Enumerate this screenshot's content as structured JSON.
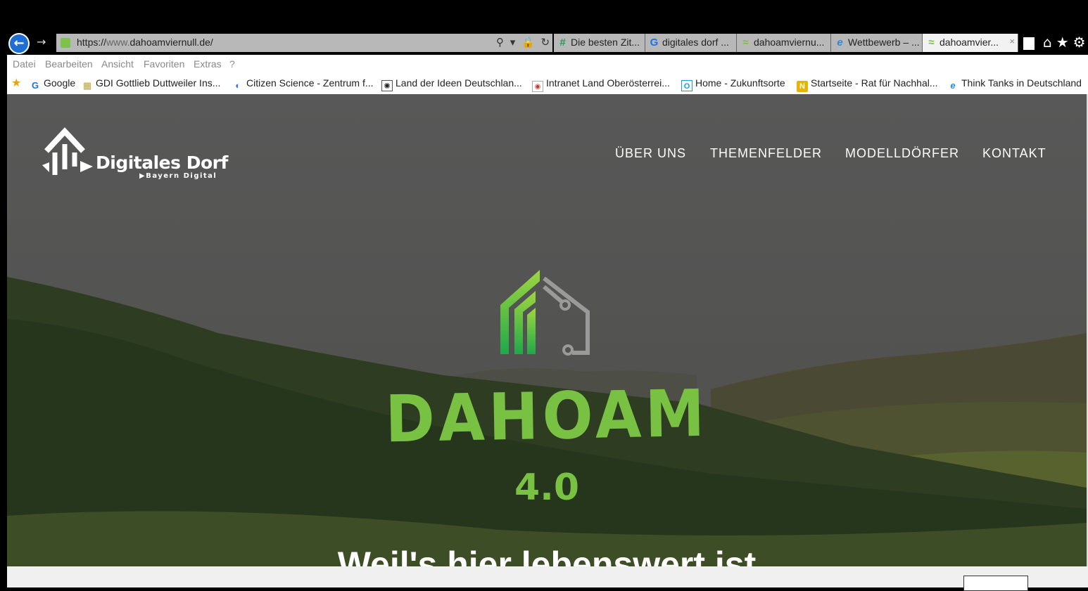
{
  "browser": {
    "url_prefix": "https://",
    "url_dim": "www.",
    "url_host": "dahoamviernull.de/",
    "address_icons": "⚲ ▾ 🔒 ↻",
    "tabs": [
      {
        "icon": "#",
        "label": "Die besten Zit..."
      },
      {
        "icon": "G",
        "label": "digitales dorf ..."
      },
      {
        "icon": "≈",
        "label": "dahoamviernu..."
      },
      {
        "icon": "e",
        "label": "Wettbewerb – ..."
      },
      {
        "icon": "≈",
        "label": "dahoamvier...",
        "close": "×"
      }
    ],
    "right_icons": "⌂★⚙"
  },
  "menu": [
    "Datei",
    "Bearbeiten",
    "Ansicht",
    "Favoriten",
    "Extras",
    "?"
  ],
  "favorites": [
    {
      "icon": "G",
      "label": "Google"
    },
    {
      "icon": "▦",
      "label": "GDI Gottlieb Duttweiler Ins..."
    },
    {
      "icon": "◐",
      "label": "Citizen Science - Zentrum f..."
    },
    {
      "icon": "✺",
      "label": "Land der Ideen  Deutschlan..."
    },
    {
      "icon": "◉",
      "label": "Intranet Land Oberösterrei..."
    },
    {
      "icon": "O",
      "label": "Home - Zukunftsorte"
    },
    {
      "icon": "N",
      "label": "Startseite - Rat für Nachhal..."
    },
    {
      "icon": "e",
      "label": "Think Tanks in Deutschland"
    }
  ],
  "site": {
    "brand_name": "Digitales Dorf",
    "brand_sub": "▶Bayern Digital",
    "nav": [
      "ÜBER UNS",
      "THEMENFELDER",
      "MODELLDÖRFER",
      "KONTAKT"
    ],
    "hero_title": "DAHOAM",
    "hero_version": "4.0",
    "tagline": "Weil's hier lebenswert ist",
    "colors": {
      "accent_green": "#79c143",
      "logo_gray": "#9a9a9a"
    }
  }
}
